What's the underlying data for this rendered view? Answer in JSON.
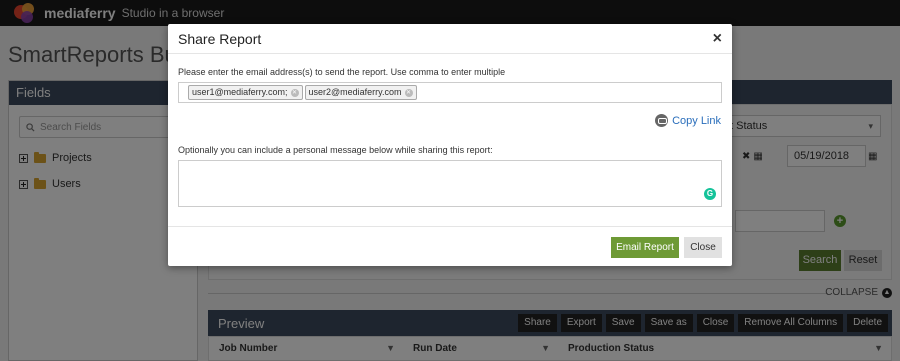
{
  "topbar": {
    "brand": "mediaferry",
    "tagline": "Studio in a browser"
  },
  "page": {
    "title": "SmartReports Builde"
  },
  "fields_panel": {
    "title": "Fields",
    "search_placeholder": "Search Fields",
    "items": [
      {
        "label": "Projects"
      },
      {
        "label": "Users"
      }
    ]
  },
  "filters": {
    "status_select": "t Status",
    "date_to": "05/19/2018",
    "search_label": "Search",
    "reset_label": "Reset",
    "collapse_label": "COLLAPSE"
  },
  "preview": {
    "title": "Preview",
    "buttons": [
      "Share",
      "Export",
      "Save",
      "Save as",
      "Close",
      "Remove All Columns",
      "Delete"
    ],
    "columns": [
      "Job Number",
      "Run Date",
      "Production Status"
    ]
  },
  "modal": {
    "title": "Share Report",
    "instruction": "Please enter the email address(s) to send the report. Use comma to enter multiple",
    "emails": [
      "user1@mediaferry.com;",
      "user2@mediaferry.com"
    ],
    "copy_link_label": "Copy Link",
    "optional_label": "Optionally you can include a personal message below while sharing this report:",
    "email_button": "Email Report",
    "close_button": "Close"
  },
  "colors": {
    "header_dark": "#3d4b5f",
    "primary_green": "#6e9a35",
    "link_blue": "#2a6ebb"
  }
}
